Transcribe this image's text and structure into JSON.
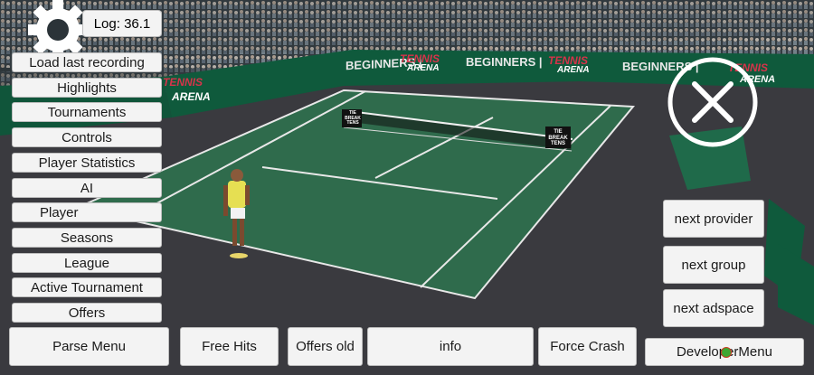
{
  "log": {
    "label": "Log: 36.1"
  },
  "menu": {
    "items": [
      {
        "label": "Load last recording"
      },
      {
        "label": "Highlights"
      },
      {
        "label": "Tournaments"
      },
      {
        "label": "Controls"
      },
      {
        "label": "Player Statistics"
      },
      {
        "label": "AI"
      },
      {
        "label": "Player"
      },
      {
        "label": "Seasons"
      },
      {
        "label": "League"
      },
      {
        "label": "Active Tournament"
      },
      {
        "label": "Offers"
      }
    ]
  },
  "bottom_bar": {
    "parse_menu": "Parse Menu",
    "free_hits": "Free Hits",
    "offers_old": "Offers old",
    "info": "info",
    "force_crash": "Force Crash",
    "developer_menu": "DeveloperMenu"
  },
  "right_panel": {
    "next_provider": "next provider",
    "next_group": "next group",
    "next_adspace": "next adspace"
  },
  "scene": {
    "banner_brand": "BEGINNERS |",
    "arena_top": "TENNIS",
    "arena_bottom": "ARENA",
    "net_sign": "TIE BREAK TENS"
  },
  "icons": {
    "settings": "gear-icon",
    "close": "close-icon"
  },
  "colors": {
    "court": "#2f6b4c",
    "surround": "#3a3a3f",
    "wall": "#0f5a3c",
    "button_bg": "#f3f3f3"
  }
}
